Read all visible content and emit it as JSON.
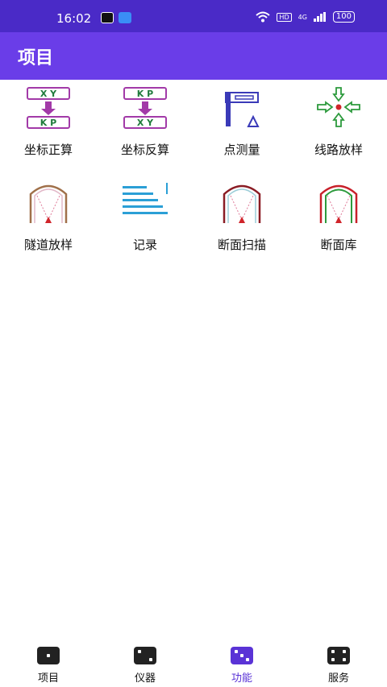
{
  "status": {
    "time": "16:02",
    "battery": "100",
    "hd": "HD",
    "network": "4G"
  },
  "appbar": {
    "title": "项目"
  },
  "functions": [
    {
      "label": "坐标正算",
      "icon": "coordinate-forward-icon"
    },
    {
      "label": "坐标反算",
      "icon": "coordinate-inverse-icon"
    },
    {
      "label": "点测量",
      "icon": "point-survey-icon"
    },
    {
      "label": "线路放样",
      "icon": "route-stakeout-icon"
    },
    {
      "label": "隧道放样",
      "icon": "tunnel-stakeout-icon"
    },
    {
      "label": "记录",
      "icon": "record-icon"
    },
    {
      "label": "断面扫描",
      "icon": "section-scan-icon"
    },
    {
      "label": "断面库",
      "icon": "section-library-icon"
    }
  ],
  "icon_text": {
    "xy": "X  Y",
    "kp": "K  P"
  },
  "nav": [
    {
      "label": "项目"
    },
    {
      "label": "仪器"
    },
    {
      "label": "功能",
      "active": true
    },
    {
      "label": "服务"
    }
  ],
  "colors": {
    "statusbar": "#4a2ac7",
    "appbar": "#6a3de8",
    "accent": "#5a33d6"
  }
}
